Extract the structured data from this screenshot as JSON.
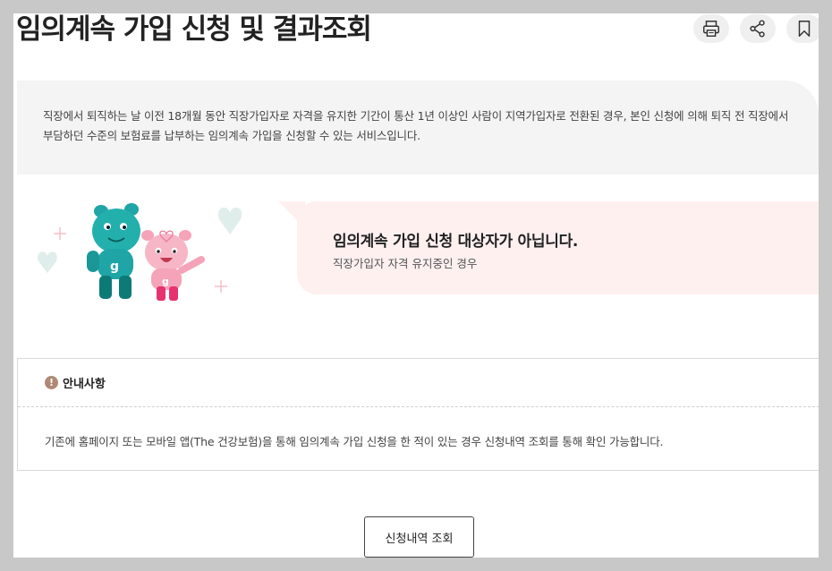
{
  "header": {
    "title": "임의계속 가입 신청 및 결과조회",
    "tools": [
      {
        "icon": "printer-icon",
        "label": "print"
      },
      {
        "icon": "share-icon",
        "label": "share"
      },
      {
        "icon": "bookmark-icon",
        "label": "bookmark"
      }
    ]
  },
  "description": {
    "text": "직장에서 퇴직하는 날 이전 18개월 동안 직장가입자로 자격을 유지한 기간이 통산 1년 이상인 사람이 지역가입자로 전환된 경우, 본인 신청에 의해 퇴직 전 직장에서 부담하던 수준의 보험료를 납부하는 임의계속 가입을 신청할 수 있는 서비스입니다."
  },
  "result": {
    "title": "임의계속 가입 신청 대상자가 아닙니다.",
    "subtitle": "직장가입자 자격 유지중인 경우"
  },
  "notice": {
    "heading": "안내사항",
    "icon_glyph": "!",
    "body": "기존에 홈페이지 또는 모바일 앱(The 건강보험)을 통해 임의계속 가입 신청을 한 적이 있는 경우 신청내역 조회를 통해 확인 가능합니다."
  },
  "actions": {
    "history_label": "신청내역 조회"
  },
  "colors": {
    "page_bg": "#ffffff",
    "frame_bg": "#c8c8c8",
    "desc_bg": "#f4f4f4",
    "result_bg": "#fff0f0",
    "notice_icon": "#b08975",
    "mascot_teal": "#1fa5a5",
    "mascot_pink": "#f4a3b8"
  }
}
